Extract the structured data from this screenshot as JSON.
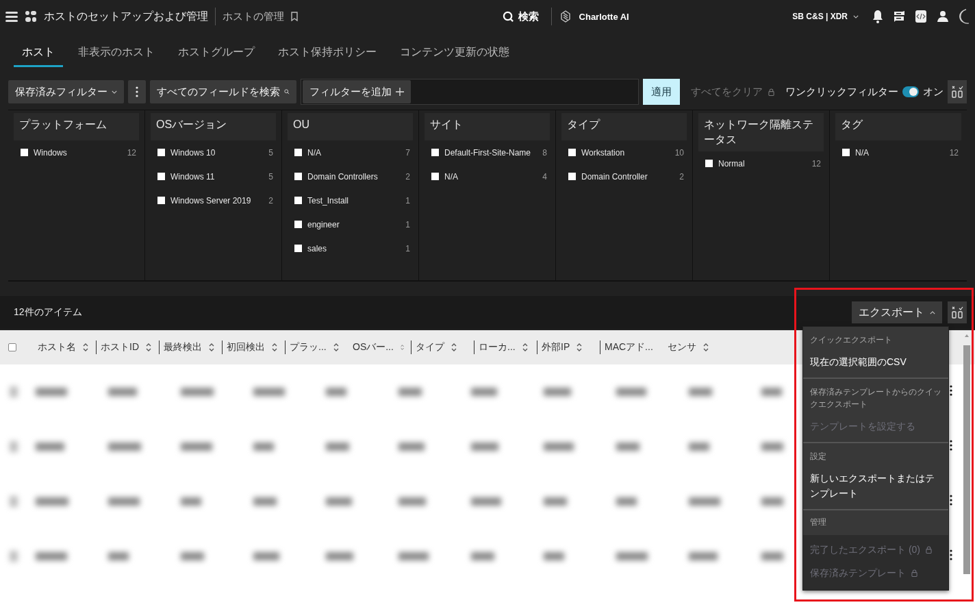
{
  "header": {
    "app_title": "ホストのセットアップおよび管理",
    "page_title": "ホストの管理",
    "search": "検索",
    "assistant": "Charlotte AI",
    "tenant": "SB C&S | XDR"
  },
  "tabs": [
    {
      "label": "ホスト",
      "selected": true
    },
    {
      "label": "非表示のホスト",
      "selected": false
    },
    {
      "label": "ホストグループ",
      "selected": false
    },
    {
      "label": "ホスト保持ポリシー",
      "selected": false
    },
    {
      "label": "コンテンツ更新の状態",
      "selected": false
    }
  ],
  "filter_bar": {
    "saved_filters": "保存済みフィルター",
    "search_fields": "すべてのフィールドを検索",
    "add_filter": "フィルターを追加",
    "apply": "適用",
    "clear_all": "すべてをクリア",
    "one_click_filter": {
      "label": "ワンクリックフィルター",
      "on": true,
      "state_label": "オン"
    }
  },
  "facets": [
    {
      "title": "プラットフォーム",
      "items": [
        {
          "label": "Windows",
          "count": "12",
          "checked": false
        }
      ]
    },
    {
      "title": "OSバージョン",
      "items": [
        {
          "label": "Windows 10",
          "count": "5",
          "checked": false
        },
        {
          "label": "Windows 11",
          "count": "5",
          "checked": false
        },
        {
          "label": "Windows Server 2019",
          "count": "2",
          "checked": false
        }
      ]
    },
    {
      "title": "OU",
      "items": [
        {
          "label": "N/A",
          "count": "7",
          "checked": false
        },
        {
          "label": "Domain Controllers",
          "count": "2",
          "checked": false
        },
        {
          "label": "Test_Install",
          "count": "1",
          "checked": false
        },
        {
          "label": "engineer",
          "count": "1",
          "checked": false
        },
        {
          "label": "sales",
          "count": "1",
          "checked": false
        }
      ]
    },
    {
      "title": "サイト",
      "items": [
        {
          "label": "Default-First-Site-Name",
          "count": "8",
          "checked": false
        },
        {
          "label": "N/A",
          "count": "4",
          "checked": false
        }
      ]
    },
    {
      "title": "タイプ",
      "items": [
        {
          "label": "Workstation",
          "count": "10",
          "checked": false
        },
        {
          "label": "Domain Controller",
          "count": "2",
          "checked": false
        }
      ]
    },
    {
      "title": "ネットワーク隔離ステータス",
      "items": [
        {
          "label": "Normal",
          "count": "12",
          "checked": false
        }
      ]
    },
    {
      "title": "タグ",
      "items": [
        {
          "label": "N/A",
          "count": "12",
          "checked": false
        }
      ]
    }
  ],
  "results": {
    "count_label": "12件のアイテム",
    "export_button": "エクスポート",
    "export_expanded": true
  },
  "table": {
    "columns": [
      {
        "label": "ホスト名",
        "separator": false
      },
      {
        "label": "ホストID",
        "separator": true
      },
      {
        "label": "最終検出",
        "separator": true
      },
      {
        "label": "初回検出",
        "separator": true
      },
      {
        "label": "プラッ...",
        "separator": true
      },
      {
        "label": "OSバー...",
        "separator": false
      },
      {
        "label": "タイプ",
        "separator": true
      },
      {
        "label": "ローカ...",
        "separator": true
      },
      {
        "label": "外部IP",
        "separator": true
      },
      {
        "label": "MACアド...",
        "separator": true
      },
      {
        "label": "センサ",
        "separator": false
      }
    ],
    "select_all_checked": false,
    "rows": [
      {
        "kind": "blurred"
      },
      {
        "kind": "blurred"
      },
      {
        "kind": "blurred"
      },
      {
        "kind": "blurred"
      }
    ]
  },
  "export_menu": [
    {
      "heading": "クイックエクスポート",
      "items": [
        {
          "label": "現在の選択範囲のCSV",
          "disabled": false,
          "locked": false
        }
      ]
    },
    {
      "heading": "保存済みテンプレートからのクイックエクスポート",
      "items": [
        {
          "label": "テンプレートを設定する",
          "disabled": true,
          "locked": false
        }
      ]
    },
    {
      "heading": "設定",
      "items": [
        {
          "label": "新しいエクスポートまたはテンプレート",
          "disabled": false,
          "locked": false
        }
      ]
    },
    {
      "heading": "管理",
      "items": [
        {
          "label": "完了したエクスポート (0)",
          "disabled": true,
          "locked": true
        },
        {
          "label": "保存済みテンプレート",
          "disabled": true,
          "locked": true
        }
      ]
    }
  ]
}
